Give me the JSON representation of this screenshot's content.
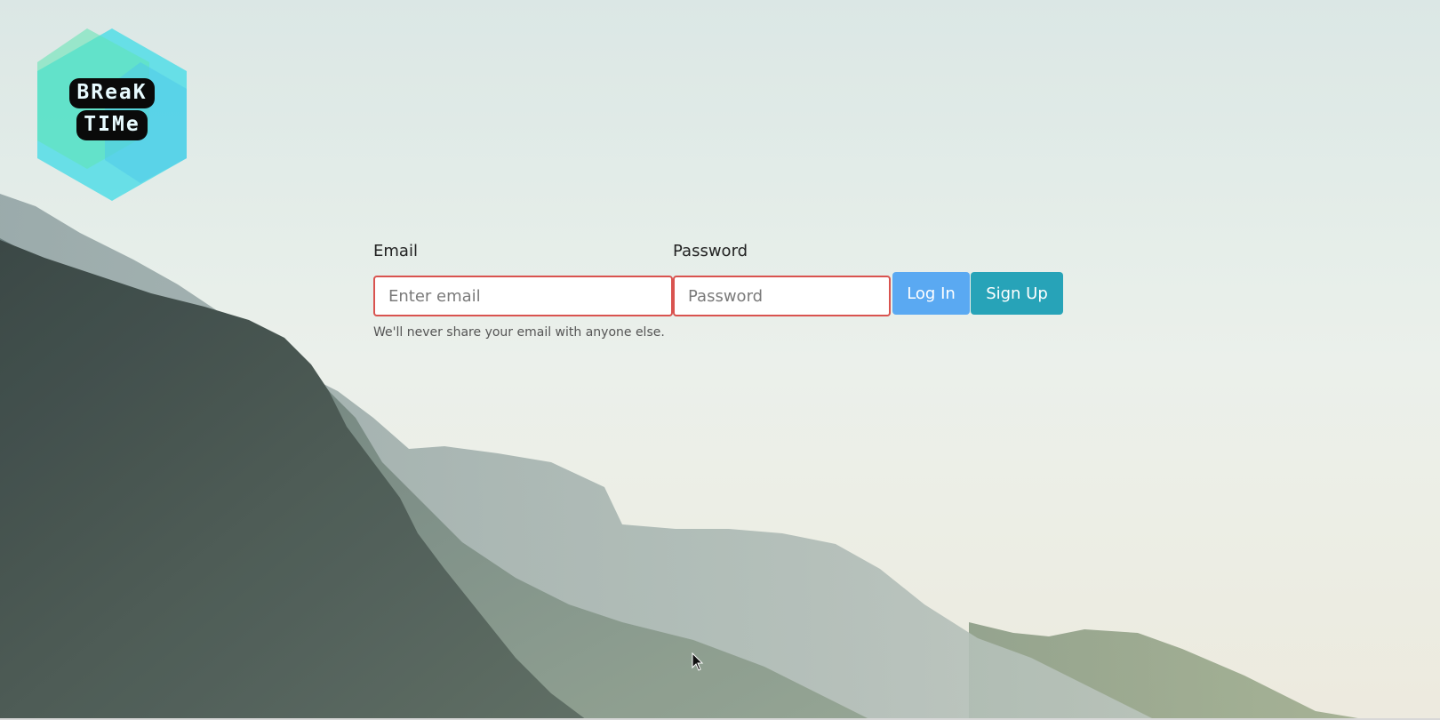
{
  "logo": {
    "line1": "BReaK",
    "line2": "TIMe"
  },
  "form": {
    "email_label": "Email",
    "email_placeholder": "Enter email",
    "email_value": "",
    "password_label": "Password",
    "password_placeholder": "Password",
    "password_value": "",
    "login_label": "Log In",
    "signup_label": "Sign Up",
    "help_text": "We'll never share your email with anyone else."
  },
  "colors": {
    "login_button": "#5aa9f2",
    "signup_button": "#27a3b8",
    "input_border_error": "#d9534f",
    "logo_teal": "#52dde6",
    "logo_green": "#5fe3b3"
  }
}
